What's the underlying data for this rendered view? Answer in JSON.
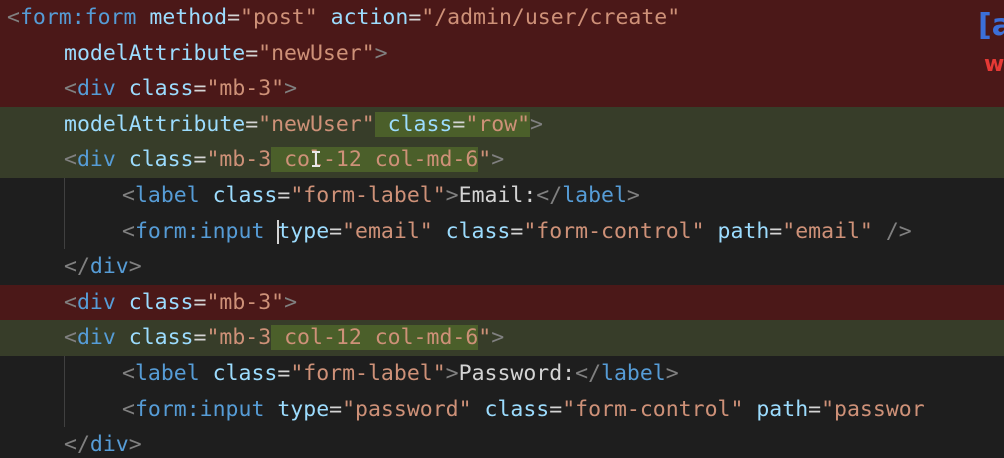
{
  "editor": {
    "lines": [
      {
        "diff": "removed",
        "tokens": [
          {
            "c": "punct",
            "t": "<"
          },
          {
            "c": "tag",
            "t": "form:form"
          },
          {
            "c": "text",
            "t": " "
          },
          {
            "c": "attr",
            "t": "method"
          },
          {
            "c": "eq",
            "t": "="
          },
          {
            "c": "str",
            "t": "\"post\""
          },
          {
            "c": "text",
            "t": " "
          },
          {
            "c": "attr",
            "t": "action"
          },
          {
            "c": "eq",
            "t": "="
          },
          {
            "c": "str",
            "t": "\"/admin/user/create\""
          }
        ]
      },
      {
        "diff": "removed",
        "tokens": [
          {
            "c": "attr",
            "t": "modelAttribute"
          },
          {
            "c": "eq",
            "t": "="
          },
          {
            "c": "str",
            "t": "\"newUser\""
          },
          {
            "c": "punct",
            "t": ">"
          }
        ]
      },
      {
        "diff": "removed",
        "tokens": [
          {
            "c": "punct",
            "t": "<"
          },
          {
            "c": "tag",
            "t": "div"
          },
          {
            "c": "text",
            "t": " "
          },
          {
            "c": "attr",
            "t": "class"
          },
          {
            "c": "eq",
            "t": "="
          },
          {
            "c": "str",
            "t": "\"mb-3\""
          },
          {
            "c": "punct",
            "t": ">"
          }
        ]
      },
      {
        "diff": "added",
        "tokens": [
          {
            "c": "attr",
            "t": "modelAttribute"
          },
          {
            "c": "eq",
            "t": "="
          },
          {
            "c": "str",
            "t": "\"newUser\""
          },
          {
            "c": "text hl",
            "t": " "
          },
          {
            "c": "attr hl",
            "t": "class"
          },
          {
            "c": "eq hl",
            "t": "="
          },
          {
            "c": "str hl",
            "t": "\"row\""
          },
          {
            "c": "punct",
            "t": ">"
          }
        ]
      },
      {
        "diff": "added",
        "tokens": [
          {
            "c": "punct",
            "t": "<"
          },
          {
            "c": "tag",
            "t": "div"
          },
          {
            "c": "text",
            "t": " "
          },
          {
            "c": "attr",
            "t": "class"
          },
          {
            "c": "eq",
            "t": "="
          },
          {
            "c": "str",
            "t": "\"mb-3"
          },
          {
            "c": "str hl",
            "t": " col-12 col-md-6"
          },
          {
            "c": "str",
            "t": "\""
          },
          {
            "c": "punct",
            "t": ">"
          }
        ]
      },
      {
        "diff": "none",
        "tokens": [
          {
            "c": "punct",
            "t": "<"
          },
          {
            "c": "tag",
            "t": "label"
          },
          {
            "c": "text",
            "t": " "
          },
          {
            "c": "attr",
            "t": "class"
          },
          {
            "c": "eq",
            "t": "="
          },
          {
            "c": "str",
            "t": "\"form-label\""
          },
          {
            "c": "punct",
            "t": ">"
          },
          {
            "c": "text",
            "t": "Email:"
          },
          {
            "c": "punct",
            "t": "</"
          },
          {
            "c": "tag",
            "t": "label"
          },
          {
            "c": "punct",
            "t": ">"
          }
        ]
      },
      {
        "diff": "none",
        "tokens": [
          {
            "c": "punct",
            "t": "<"
          },
          {
            "c": "tag",
            "t": "form:input"
          },
          {
            "c": "text",
            "t": " "
          },
          {
            "c": "caret",
            "t": ""
          },
          {
            "c": "attr",
            "t": "type"
          },
          {
            "c": "eq",
            "t": "="
          },
          {
            "c": "str",
            "t": "\"email\""
          },
          {
            "c": "text",
            "t": " "
          },
          {
            "c": "attr",
            "t": "class"
          },
          {
            "c": "eq",
            "t": "="
          },
          {
            "c": "str",
            "t": "\"form-control\""
          },
          {
            "c": "text",
            "t": " "
          },
          {
            "c": "attr",
            "t": "path"
          },
          {
            "c": "eq",
            "t": "="
          },
          {
            "c": "str",
            "t": "\"email\""
          },
          {
            "c": "text",
            "t": " "
          },
          {
            "c": "punct",
            "t": "/>"
          }
        ]
      },
      {
        "diff": "none",
        "tokens": [
          {
            "c": "punct",
            "t": "</"
          },
          {
            "c": "tag",
            "t": "div"
          },
          {
            "c": "punct",
            "t": ">"
          }
        ]
      },
      {
        "diff": "removed",
        "tokens": [
          {
            "c": "punct",
            "t": "<"
          },
          {
            "c": "tag",
            "t": "div"
          },
          {
            "c": "text",
            "t": " "
          },
          {
            "c": "attr",
            "t": "class"
          },
          {
            "c": "eq",
            "t": "="
          },
          {
            "c": "str",
            "t": "\"mb-3\""
          },
          {
            "c": "punct",
            "t": ">"
          }
        ]
      },
      {
        "diff": "added",
        "tokens": [
          {
            "c": "punct",
            "t": "<"
          },
          {
            "c": "tag",
            "t": "div"
          },
          {
            "c": "text",
            "t": " "
          },
          {
            "c": "attr",
            "t": "class"
          },
          {
            "c": "eq",
            "t": "="
          },
          {
            "c": "str",
            "t": "\"mb-3"
          },
          {
            "c": "str hl",
            "t": " col-12 col-md-6"
          },
          {
            "c": "str",
            "t": "\""
          },
          {
            "c": "punct",
            "t": ">"
          }
        ]
      },
      {
        "diff": "none",
        "tokens": [
          {
            "c": "punct",
            "t": "<"
          },
          {
            "c": "tag",
            "t": "label"
          },
          {
            "c": "text",
            "t": " "
          },
          {
            "c": "attr",
            "t": "class"
          },
          {
            "c": "eq",
            "t": "="
          },
          {
            "c": "str",
            "t": "\"form-label\""
          },
          {
            "c": "punct",
            "t": ">"
          },
          {
            "c": "text",
            "t": "Password:"
          },
          {
            "c": "punct",
            "t": "</"
          },
          {
            "c": "tag",
            "t": "label"
          },
          {
            "c": "punct",
            "t": ">"
          }
        ]
      },
      {
        "diff": "none",
        "tokens": [
          {
            "c": "punct",
            "t": "<"
          },
          {
            "c": "tag",
            "t": "form:input"
          },
          {
            "c": "text",
            "t": " "
          },
          {
            "c": "attr",
            "t": "type"
          },
          {
            "c": "eq",
            "t": "="
          },
          {
            "c": "str",
            "t": "\"password\""
          },
          {
            "c": "text",
            "t": " "
          },
          {
            "c": "attr",
            "t": "class"
          },
          {
            "c": "eq",
            "t": "="
          },
          {
            "c": "str",
            "t": "\"form-control\""
          },
          {
            "c": "text",
            "t": " "
          },
          {
            "c": "attr",
            "t": "path"
          },
          {
            "c": "eq",
            "t": "="
          },
          {
            "c": "str",
            "t": "\"passwor"
          }
        ]
      },
      {
        "diff": "none",
        "tokens": [
          {
            "c": "punct",
            "t": "</"
          },
          {
            "c": "tag",
            "t": "div"
          },
          {
            "c": "punct",
            "t": ">"
          }
        ]
      }
    ]
  },
  "overlay": {
    "top": "[a",
    "bottom": "w"
  },
  "colors": {
    "background": "#1e1e1e",
    "removed_line": "#4b1818",
    "added_line": "#373d29",
    "added_highlight": "#4b5f2a",
    "tag": "#569cd6",
    "attribute": "#9cdcfe",
    "string": "#ce9178",
    "text": "#d4d4d4",
    "punctuation": "#808080"
  },
  "icons": [
    "text-cursor-icon"
  ]
}
